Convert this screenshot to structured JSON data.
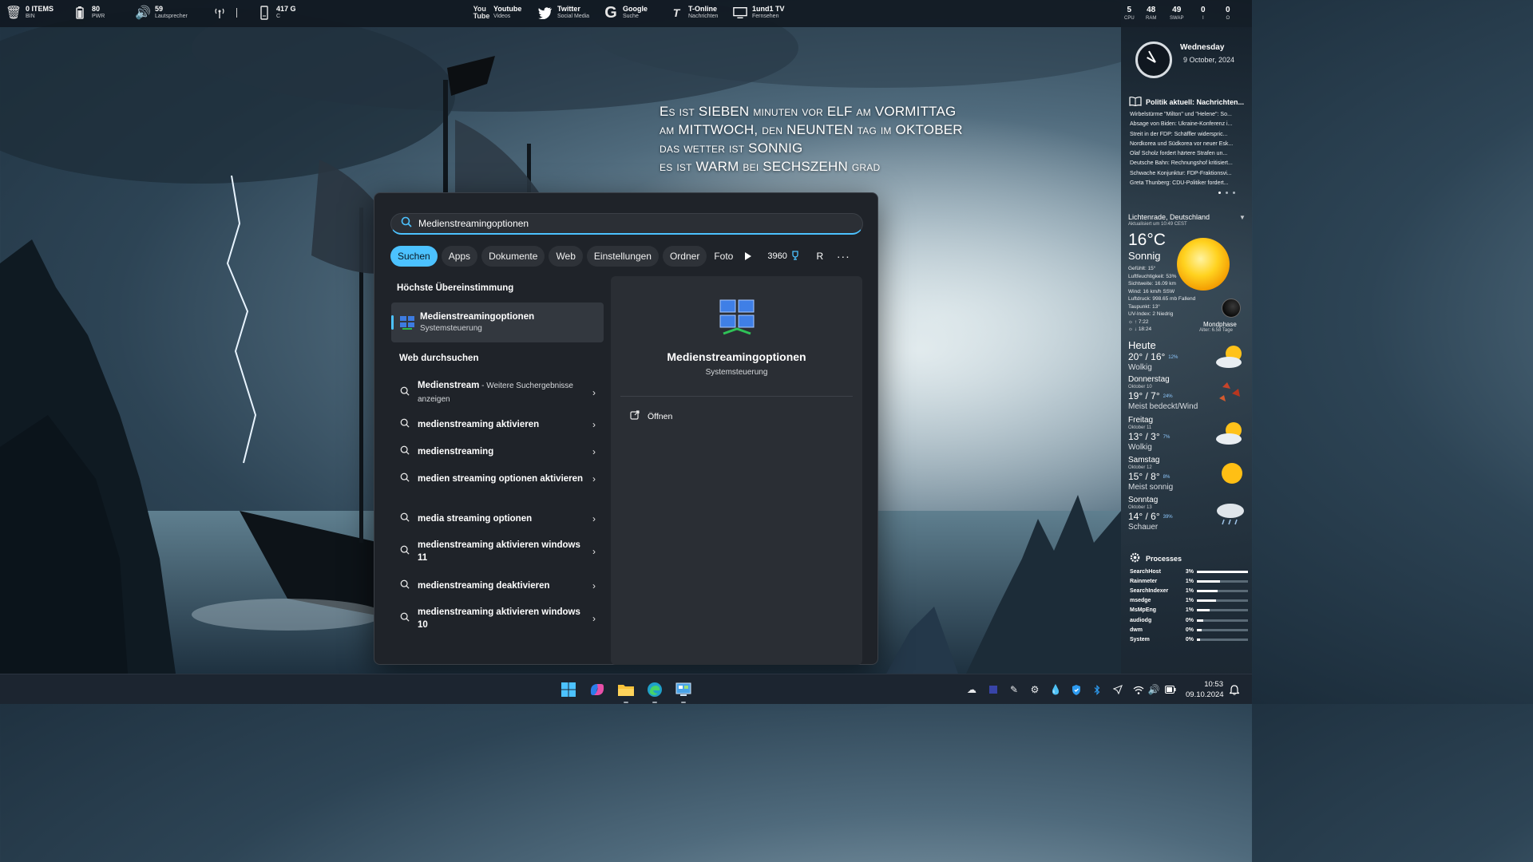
{
  "topbar": {
    "left": [
      {
        "icon": "trash-icon",
        "value": "0 ITEMS",
        "sub": "BIN"
      },
      {
        "icon": "battery-icon",
        "value": "80",
        "sub": "PWR"
      },
      {
        "icon": "speaker-icon",
        "value": "59",
        "sub": "Lautsprecher"
      },
      {
        "icon": "antenna-icon",
        "value": "",
        "sub": ""
      },
      {
        "icon": "drive-icon",
        "value": "417 G",
        "sub": "C"
      }
    ],
    "center": [
      {
        "icon": "youtube-icon",
        "value": "Youtube",
        "sub": "Videos"
      },
      {
        "icon": "twitter-icon",
        "value": "Twitter",
        "sub": "Social Media"
      },
      {
        "icon": "google-icon",
        "value": "Google",
        "sub": "Suche"
      },
      {
        "icon": "t-online-icon",
        "value": "T-Online",
        "sub": "Nachrichten"
      },
      {
        "icon": "tv-icon",
        "value": "1und1 TV",
        "sub": "Fernsehen"
      }
    ],
    "stats": [
      {
        "value": "5",
        "sub": "CPU"
      },
      {
        "value": "48",
        "sub": "RAM"
      },
      {
        "value": "49",
        "sub": "SWAP"
      },
      {
        "value": "0",
        "sub": "I"
      },
      {
        "value": "0",
        "sub": "O"
      }
    ]
  },
  "wordclock": [
    "Es ist SIEBEN minuten vor ELF am VORMITTAG",
    "am MITTWOCH, den NEUNTEN tag im OKTOBER",
    "das wetter ist SONNIG",
    "es ist WARM bei SECHSZEHN grad"
  ],
  "sidebar": {
    "day": "Wednesday",
    "date": "9 October, 2024",
    "news_title": "Politik aktuell: Nachrichten...",
    "news": [
      "Wirbelstürme \"Milton\" und \"Helene\": So...",
      "Absage von Biden: Ukraine-Konferenz i...",
      "Streit in der FDP: Schäffler widerspric...",
      "Nordkorea und Südkorea vor neuer Esk...",
      "Olaf Scholz fordert härtere Strafen un...",
      "Deutsche Bahn: Rechnungshof kritisiert...",
      "Schwache Konjunktur: FDP-Fraktionsvi...",
      "Greta Thunberg: CDU-Politiker fordert..."
    ],
    "weather": {
      "location": "Lichtenrade, Deutschland",
      "updated": "Aktualisiert um 10:49 CEST",
      "temp": "16°C",
      "condition": "Sonnig",
      "details": [
        "Gefühlt: 15°",
        "Luftfeuchtigkeit: 53%",
        "Sichtweite: 16.09 km",
        "Wind: 16 km/h SSW",
        "Luftdruck: 998.65 mb Fallend",
        "Taupunkt: 13°",
        "UV-Index: 2 Niedrig",
        "☼ ↑ 7:22",
        "☼ ↓ 18:24"
      ],
      "moon_label": "Mondphase",
      "moon_age": "Alter: 6.58 Tage",
      "forecast": [
        {
          "day": "Heute",
          "date": "",
          "temps": "20° / 16°",
          "rain": "12%",
          "cond": "Wolkig",
          "icon": "partly-cloudy-icon"
        },
        {
          "day": "Donnerstag",
          "date": "Oktober 10",
          "temps": "19° / 7°",
          "rain": "24%",
          "cond": "Meist bedeckt/Wind",
          "icon": "windy-cloud-icon"
        },
        {
          "day": "Freitag",
          "date": "Oktober 11",
          "temps": "13° / 3°",
          "rain": "7%",
          "cond": "Wolkig",
          "icon": "partly-cloudy-icon"
        },
        {
          "day": "Samstag",
          "date": "Oktober 12",
          "temps": "15° / 8°",
          "rain": "8%",
          "cond": "Meist sonnig",
          "icon": "sunny-icon"
        },
        {
          "day": "Sonntag",
          "date": "Oktober 13",
          "temps": "14° / 6°",
          "rain": "39%",
          "cond": "Schauer",
          "icon": "showers-icon"
        }
      ]
    },
    "processes_title": "Processes",
    "processes": [
      {
        "name": "SearchHost",
        "pct": "3%",
        "level": 1.0
      },
      {
        "name": "Rainmeter",
        "pct": "1%",
        "level": 0.45
      },
      {
        "name": "SearchIndexer",
        "pct": "1%",
        "level": 0.4
      },
      {
        "name": "msedge",
        "pct": "1%",
        "level": 0.38
      },
      {
        "name": "MsMpEng",
        "pct": "1%",
        "level": 0.25
      },
      {
        "name": "audiodg",
        "pct": "0%",
        "level": 0.12
      },
      {
        "name": "dwm",
        "pct": "0%",
        "level": 0.1
      },
      {
        "name": "System",
        "pct": "0%",
        "level": 0.06
      }
    ]
  },
  "search": {
    "query": "Medienstreamingoptionen",
    "filters": [
      "Suchen",
      "Apps",
      "Dokumente",
      "Web",
      "Einstellungen",
      "Ordner",
      "Foto"
    ],
    "active_filter": "Suchen",
    "points": "3960",
    "profile_initial": "R",
    "more": "···",
    "best_match_title": "Höchste Übereinstimmung",
    "best_match": {
      "name": "Medienstreamingoptionen",
      "category": "Systemsteuerung"
    },
    "web_title": "Web durchsuchen",
    "suggestions": [
      {
        "text": "Medienstream",
        "extra": " - Weitere Suchergebnisse anzeigen"
      },
      {
        "text": "medienstreaming aktivieren",
        "extra": ""
      },
      {
        "text": "medienstreaming",
        "extra": ""
      },
      {
        "text": "medien streaming optionen aktivieren",
        "extra": ""
      },
      {
        "text": "media streaming optionen",
        "extra": ""
      },
      {
        "text": "medienstreaming aktivieren windows 11",
        "extra": ""
      },
      {
        "text": "medienstreaming deaktivieren",
        "extra": ""
      },
      {
        "text": "medienstreaming aktivieren windows 10",
        "extra": ""
      }
    ],
    "detail": {
      "name": "Medienstreamingoptionen",
      "category": "Systemsteuerung",
      "open_label": "Öffnen"
    }
  },
  "taskbar": {
    "apps": [
      "windows-start-icon",
      "copilot-icon",
      "file-explorer-icon",
      "edge-icon",
      "control-panel-icon"
    ],
    "time": "10:53",
    "date": "09.10.2024"
  },
  "colors": {
    "accent": "#4cc2ff",
    "panel": "#1f2329",
    "detail_panel": "#2a2e34"
  }
}
